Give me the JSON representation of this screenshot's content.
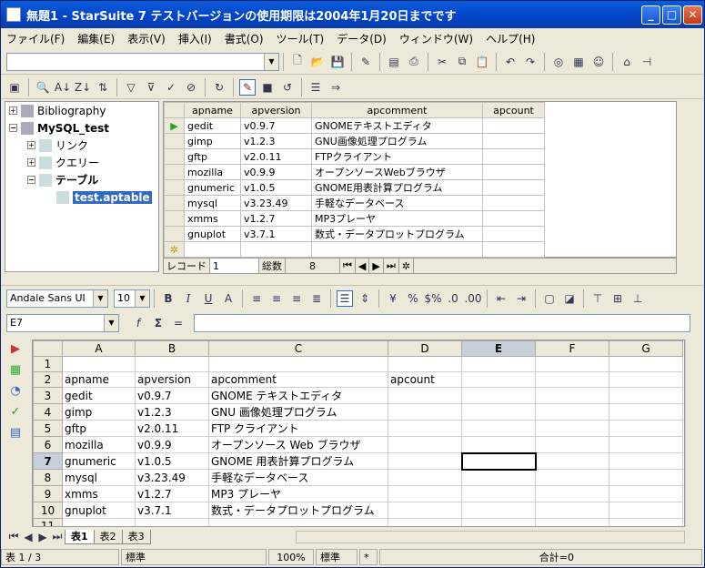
{
  "window": {
    "title": "無題1 - StarSuite 7 テストバージョンの使用期限は2004年1月20日までです",
    "minimize": "_",
    "maximize": "□",
    "close": "✕"
  },
  "menu": [
    "ファイル(F)",
    "編集(E)",
    "表示(V)",
    "挿入(I)",
    "書式(O)",
    "ツール(T)",
    "データ(D)",
    "ウィンドウ(W)",
    "ヘルプ(H)"
  ],
  "tree": {
    "items": [
      "Bibliography",
      "MySQL_test",
      "リンク",
      "クエリー",
      "テーブル",
      "test.aptable"
    ]
  },
  "dbgrid": {
    "columns": [
      "apname",
      "apversion",
      "apcomment",
      "apcount"
    ],
    "rows": [
      [
        "gedit",
        "v0.9.7",
        "GNOMEテキストエディタ",
        ""
      ],
      [
        "gimp",
        "v1.2.3",
        "GNU画像処理プログラム",
        ""
      ],
      [
        "gftp",
        "v2.0.11",
        "FTPクライアント",
        ""
      ],
      [
        "mozilla",
        "v0.9.9",
        "オープンソースWebブラウザ",
        ""
      ],
      [
        "gnumeric",
        "v1.0.5",
        "GNOME用表計算プログラム",
        ""
      ],
      [
        "mysql",
        "v3.23.49",
        "手軽なデータベース",
        ""
      ],
      [
        "xmms",
        "v1.2.7",
        "MP3プレーヤ",
        ""
      ],
      [
        "gnuplot",
        "v3.7.1",
        "数式・データプロットプログラム",
        ""
      ]
    ],
    "nav": {
      "record_label": "レコード",
      "record_value": "1",
      "total_label": "総数",
      "total_value": "8"
    }
  },
  "format": {
    "font": "Andale Sans UI",
    "size": "10"
  },
  "formula": {
    "cell_ref": "E7",
    "value": ""
  },
  "sheet": {
    "columns": [
      "A",
      "B",
      "C",
      "D",
      "E",
      "F",
      "G"
    ],
    "rows": [
      [
        "1",
        "",
        "",
        "",
        "",
        "",
        "",
        ""
      ],
      [
        "2",
        "apname",
        "apversion",
        "apcomment",
        "apcount",
        "",
        "",
        ""
      ],
      [
        "3",
        "gedit",
        "v0.9.7",
        "GNOME テキストエディタ",
        "",
        "",
        "",
        ""
      ],
      [
        "4",
        "gimp",
        "v1.2.3",
        "GNU 画像処理プログラム",
        "",
        "",
        "",
        ""
      ],
      [
        "5",
        "gftp",
        "v2.0.11",
        "FTP クライアント",
        "",
        "",
        "",
        ""
      ],
      [
        "6",
        "mozilla",
        "v0.9.9",
        "オープンソース Web ブラウザ",
        "",
        "",
        "",
        ""
      ],
      [
        "7",
        "gnumeric",
        "v1.0.5",
        "GNOME 用表計算プログラム",
        "",
        "",
        "",
        ""
      ],
      [
        "8",
        "mysql",
        "v3.23.49",
        "手軽なデータベース",
        "",
        "",
        "",
        ""
      ],
      [
        "9",
        "xmms",
        "v1.2.7",
        "MP3 プレーヤ",
        "",
        "",
        "",
        ""
      ],
      [
        "10",
        "gnuplot",
        "v3.7.1",
        "数式・データプロットプログラム",
        "",
        "",
        "",
        ""
      ],
      [
        "11",
        "",
        "",
        "",
        "",
        "",
        "",
        ""
      ]
    ]
  },
  "tabs": [
    "表1",
    "表2",
    "表3"
  ],
  "status": {
    "sheet": "表 1 / 3",
    "style": "標準",
    "zoom": "100%",
    "mode": "標準",
    "sel": "*",
    "sum": "合計=0"
  }
}
